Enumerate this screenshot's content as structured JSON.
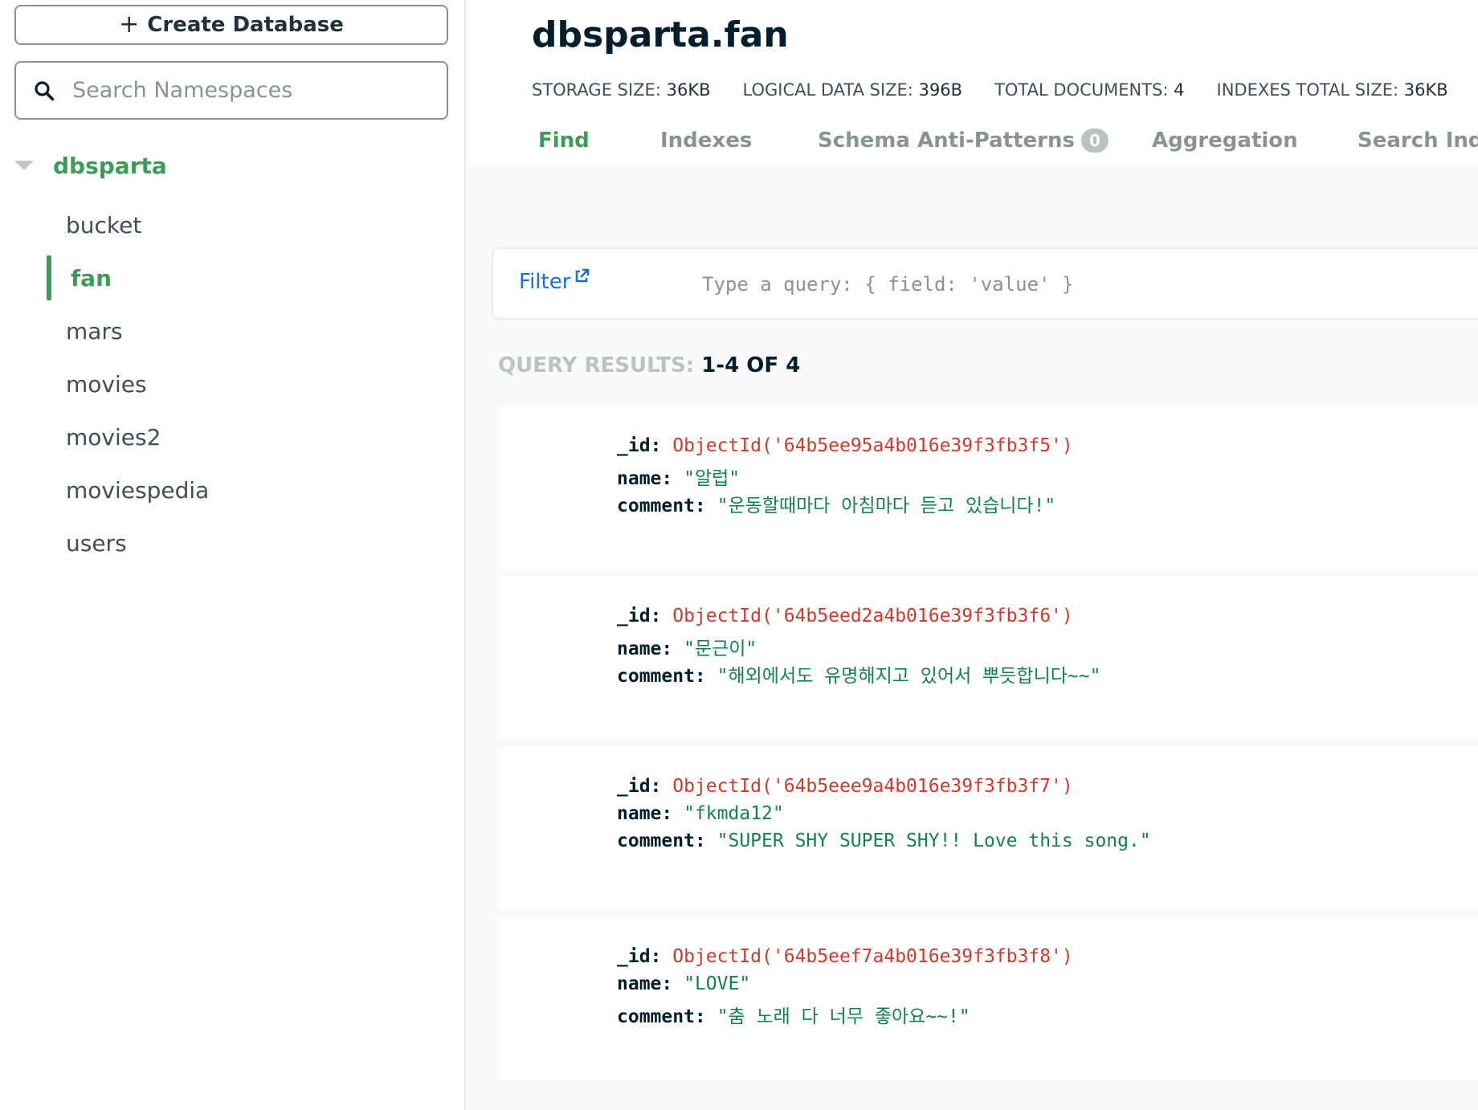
{
  "sidebar": {
    "create_button": {
      "icon": "plus-icon",
      "label": "Create Database"
    },
    "search": {
      "placeholder": "Search Namespaces",
      "value": ""
    },
    "database": {
      "name": "dbsparta",
      "expanded": true
    },
    "collections": [
      {
        "label": "bucket",
        "active": false
      },
      {
        "label": "fan",
        "active": true
      },
      {
        "label": "mars",
        "active": false
      },
      {
        "label": "movies",
        "active": false
      },
      {
        "label": "movies2",
        "active": false
      },
      {
        "label": "moviespedia",
        "active": false
      },
      {
        "label": "users",
        "active": false
      }
    ]
  },
  "header": {
    "title": "dbsparta.fan",
    "stats": [
      {
        "label": "STORAGE SIZE:",
        "value": "36KB"
      },
      {
        "label": "LOGICAL DATA SIZE:",
        "value": "396B"
      },
      {
        "label": "TOTAL DOCUMENTS:",
        "value": "4"
      },
      {
        "label": "INDEXES TOTAL SIZE:",
        "value": "36KB"
      }
    ]
  },
  "tabs": [
    {
      "label": "Find",
      "active": true
    },
    {
      "label": "Indexes",
      "active": false
    },
    {
      "label": "Schema Anti-Patterns",
      "active": false,
      "badge": "0"
    },
    {
      "label": "Aggregation",
      "active": false
    },
    {
      "label": "Search Inde",
      "active": false
    }
  ],
  "filter": {
    "label": "Filter",
    "placeholder": "Type a query: { field: 'value' }",
    "value": ""
  },
  "results": {
    "label": "QUERY RESULTS:",
    "range": "1-4 OF 4"
  },
  "documents": [
    {
      "id_key": "_id:",
      "id": "ObjectId('64b5ee95a4b016e39f3fb3f5')",
      "name_key": "name:",
      "name": "\"알럽\"",
      "comment_key": "comment:",
      "comment": "\"운동할때마다 아침마다 듣고 있습니다!\""
    },
    {
      "id_key": "_id:",
      "id": "ObjectId('64b5eed2a4b016e39f3fb3f6')",
      "name_key": "name:",
      "name": "\"문근이\"",
      "comment_key": "comment:",
      "comment": "\"해외에서도 유명해지고 있어서 뿌듯합니다~~\""
    },
    {
      "id_key": "_id:",
      "id": "ObjectId('64b5eee9a4b016e39f3fb3f7')",
      "name_key": "name:",
      "name": "\"fkmda12\"",
      "comment_key": "comment:",
      "comment": "\"SUPER SHY SUPER SHY!! Love this song.\""
    },
    {
      "id_key": "_id:",
      "id": "ObjectId('64b5eef7a4b016e39f3fb3f8')",
      "name_key": "name:",
      "name": "\"LOVE\"",
      "comment_key": "comment:",
      "comment": "\"춤 노래 다 너무 좋아요~~!\""
    }
  ],
  "colors": {
    "accent_green": "#3d9b57",
    "link_blue": "#1a6fd6",
    "objectid_red": "#cf3a2b",
    "string_green": "#12824c"
  }
}
